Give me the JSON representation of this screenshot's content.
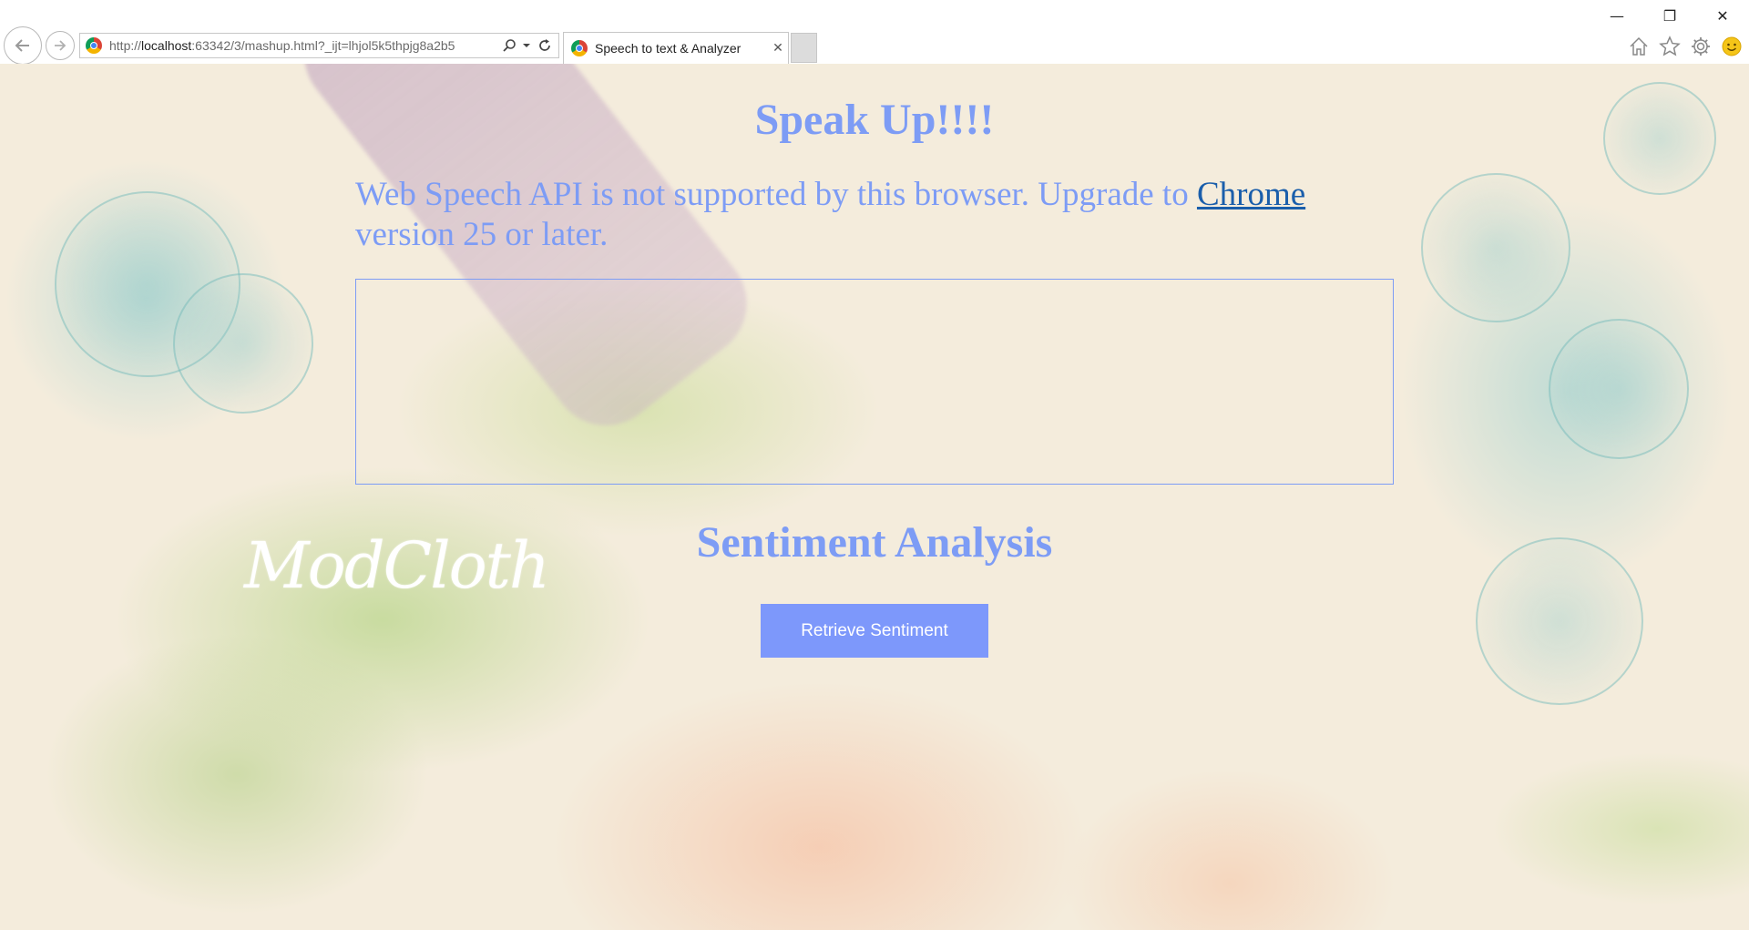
{
  "window": {
    "controls": [
      "—",
      "❐",
      "✕"
    ]
  },
  "address_bar": {
    "url_prefix": "http://",
    "url_host": "localhost",
    "url_rest": ":63342/3/mashup.html?_ijt=lhjol5k5thpjg8a2b5"
  },
  "tab": {
    "title": "Speech to text & Analyzer",
    "close": "✕"
  },
  "page": {
    "title": "Speak Up!!!!",
    "info_before_link": "Web Speech API is not supported by this browser. Upgrade to ",
    "info_link": "Chrome",
    "info_after_link": " version 25 or later.",
    "transcript": "",
    "section_title": "Sentiment Analysis",
    "logo": "ModCloth",
    "button_label": "Retrieve Sentiment"
  },
  "colors": {
    "accent": "#7d9cf5",
    "button": "#7d98fb",
    "link": "#1a5eab"
  }
}
